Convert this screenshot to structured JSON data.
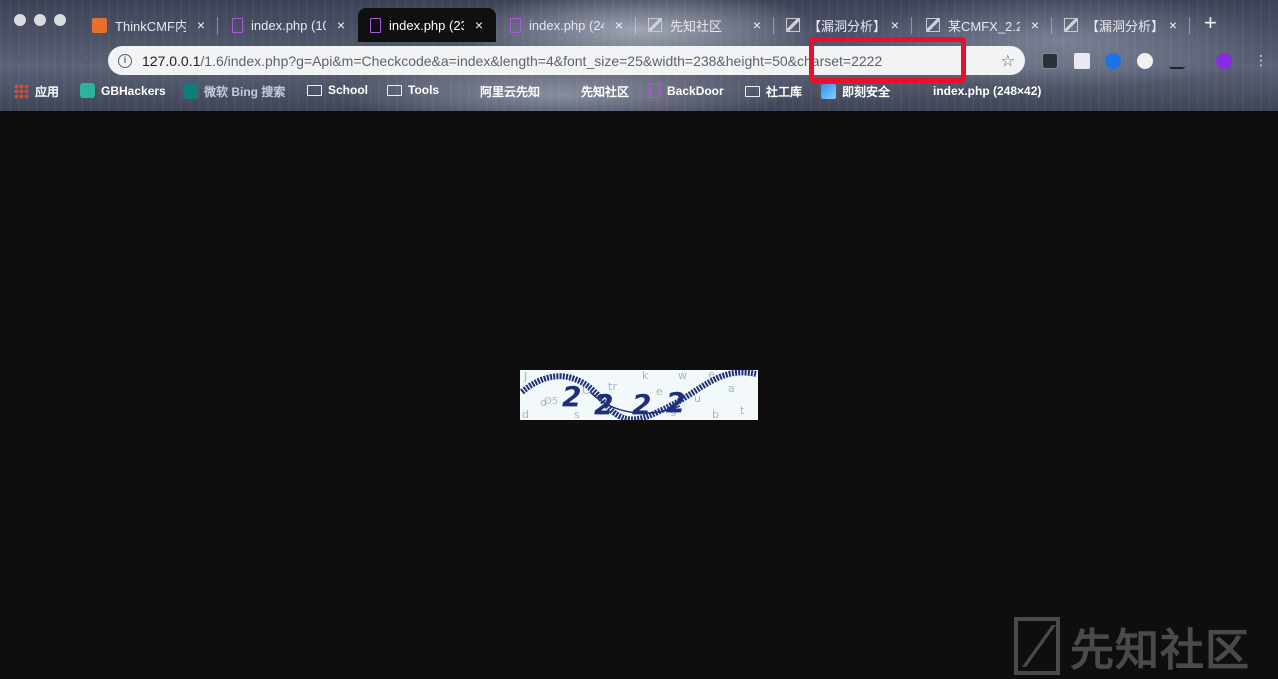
{
  "tabs": [
    {
      "title": "ThinkCMF内容",
      "active": false
    },
    {
      "title": "index.php (10",
      "active": false
    },
    {
      "title": "index.php (23",
      "active": true
    },
    {
      "title": "index.php (24",
      "active": false
    },
    {
      "title": "先知社区",
      "active": false
    },
    {
      "title": "【漏洞分析】",
      "active": false
    },
    {
      "title": "某CMFX_2.2",
      "active": false
    },
    {
      "title": "【漏洞分析】",
      "active": false
    }
  ],
  "close_glyph": "×",
  "new_tab_glyph": "+",
  "address_bar": {
    "host": "127.0.0.1",
    "path": "/1.6/index.php?g=Api&m=Checkcode&a=index&length=4&font_size=25&width=238&height=50&charset=2222",
    "highlighted_part": "0&charset=2222",
    "star_glyph": "☆"
  },
  "bookmarks": [
    {
      "label": "应用",
      "icon": "apps-grid-icon"
    },
    {
      "label": "GBHackers",
      "icon": "gbhackers-icon"
    },
    {
      "label": "微软 Bing 搜索",
      "icon": "bing-icon"
    },
    {
      "label": "School",
      "icon": "folder-icon"
    },
    {
      "label": "Tools",
      "icon": "folder-icon"
    },
    {
      "label": "阿里云先知",
      "icon": "xz-icon"
    },
    {
      "label": "先知社区",
      "icon": "xz-icon"
    },
    {
      "label": "BackDoor",
      "icon": "doc-icon"
    },
    {
      "label": "社工库",
      "icon": "folder-icon"
    },
    {
      "label": "即刻安全",
      "icon": "jike-icon"
    },
    {
      "label": "index.php (248×42)",
      "icon": "doc-icon"
    }
  ],
  "captcha": {
    "code": "2222"
  },
  "watermark": {
    "text": "先知社区"
  },
  "colors": {
    "highlight_box": "#e8102b",
    "page_bg": "#0e0e0e",
    "captcha_text": "#1c2f7a"
  }
}
